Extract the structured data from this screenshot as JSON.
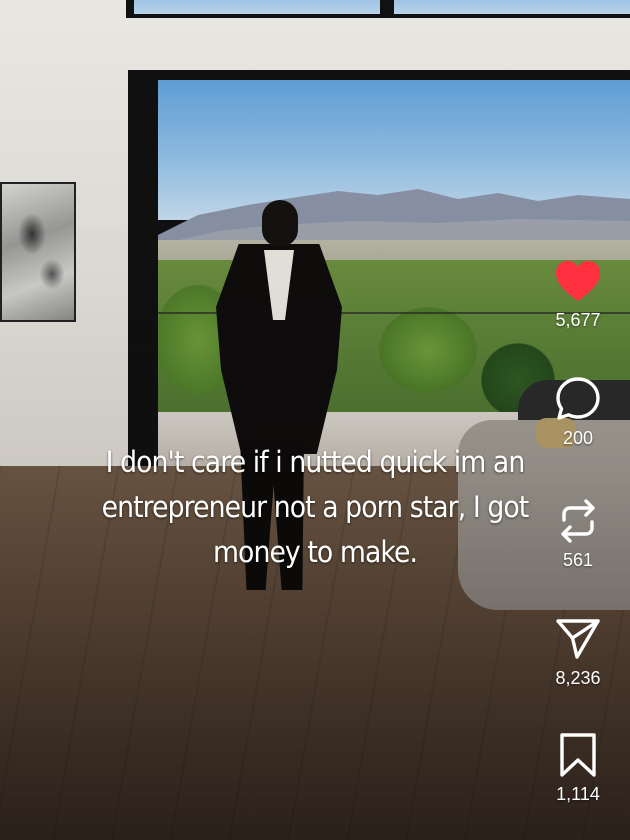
{
  "post": {
    "caption_lines": [
      "I don't care if i nutted quick im an",
      "entrepreneur not a porn star, I got",
      "money to make."
    ]
  },
  "actions": {
    "like": {
      "icon": "heart-icon",
      "count": "5,677",
      "active": true,
      "color": "#ff3040"
    },
    "comment": {
      "icon": "comment-icon",
      "count": "200"
    },
    "repost": {
      "icon": "repost-icon",
      "count": "561"
    },
    "share": {
      "icon": "send-icon",
      "count": "8,236"
    },
    "save": {
      "icon": "bookmark-icon",
      "count": "1,114"
    }
  }
}
